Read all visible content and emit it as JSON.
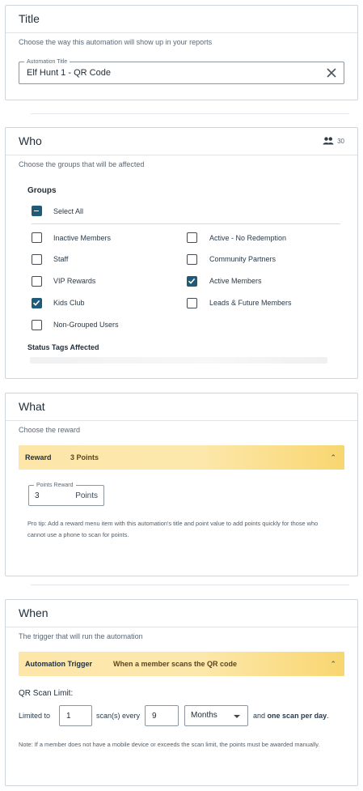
{
  "title_card": {
    "heading": "Title",
    "subtitle": "Choose the way this automation will show up in your reports",
    "field_legend": "Automation Title",
    "field_value": "Elf Hunt 1 - QR Code"
  },
  "who_card": {
    "heading": "Who",
    "member_count": "30",
    "subtitle": "Choose the groups that will be affected",
    "groups_label": "Groups",
    "select_all_label": "Select All",
    "groups": [
      {
        "label": "Inactive Members",
        "checked": false
      },
      {
        "label": "Active - No Redemption",
        "checked": false
      },
      {
        "label": "Staff",
        "checked": false
      },
      {
        "label": "Community Partners",
        "checked": false
      },
      {
        "label": "VIP Rewards",
        "checked": false
      },
      {
        "label": "Active Members",
        "checked": true
      },
      {
        "label": "Kids Club",
        "checked": true
      },
      {
        "label": "Leads & Future Members",
        "checked": false
      },
      {
        "label": "Non-Grouped Users",
        "checked": false
      }
    ],
    "status_tags_label": "Status Tags Affected"
  },
  "what_card": {
    "heading": "What",
    "subtitle": "Choose the reward",
    "bar_key": "Reward",
    "bar_value": "3 Points",
    "points_legend": "Points Reward",
    "points_value": "3",
    "points_unit": "Points",
    "tip": "Pro tip: Add a reward menu item with this automation's title and point value to add points quickly for those who cannot use a phone to scan for points."
  },
  "when_card": {
    "heading": "When",
    "subtitle": "The trigger that will run the automation",
    "bar_key": "Automation Trigger",
    "bar_value": "When a member scans the QR code",
    "scan_limit_title": "QR Scan Limit:",
    "limited_to": "Limited to",
    "limit_value": "1",
    "scans_every": "scan(s) every",
    "period_value": "9",
    "period_unit": "Months",
    "and_text": "and",
    "one_per_day": "one scan per day",
    "period_dot": ".",
    "note": "Note: If a member does not have a mobile device or exceeds the scan limit, the points must be awarded manually."
  },
  "colors": {
    "accent_checkbox": "#1f5a78",
    "bar_gradient_start": "#fde6a8",
    "bar_gradient_end": "#f8d670"
  },
  "icons": {
    "clear": "close-icon",
    "people": "people-icon",
    "collapse": "chevron-up-icon",
    "dropdown": "caret-down-icon"
  }
}
